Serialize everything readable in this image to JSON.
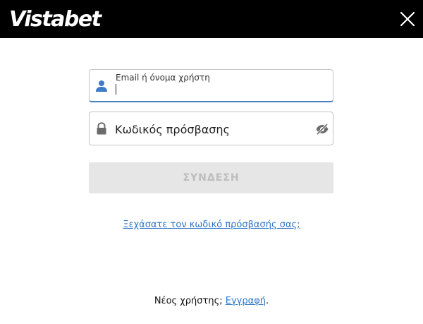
{
  "header": {
    "logo_text": "Vistabet",
    "close_icon": "close-icon"
  },
  "login_form": {
    "email": {
      "label": "Email ή όνομα χρήστη",
      "value": "",
      "icon": "user-icon"
    },
    "password": {
      "placeholder": "Κωδικός πρόσβασης",
      "value": "",
      "icon": "lock-icon",
      "toggle_icon": "eye-slash-icon"
    },
    "submit_label": "ΣΥΝΔΕΣΗ",
    "forgot_label": "Ξεχάσατε τον κωδικό πρόσβασής σας;"
  },
  "register": {
    "prompt": "Νέος χρήστης;",
    "link_label": "Εγγραφή",
    "suffix": "."
  },
  "colors": {
    "header_bg": "#000000",
    "accent": "#4a7fc4",
    "link": "#2e74c5",
    "button_disabled_bg": "#e6e6e6",
    "button_disabled_text": "#bdbdbd"
  }
}
